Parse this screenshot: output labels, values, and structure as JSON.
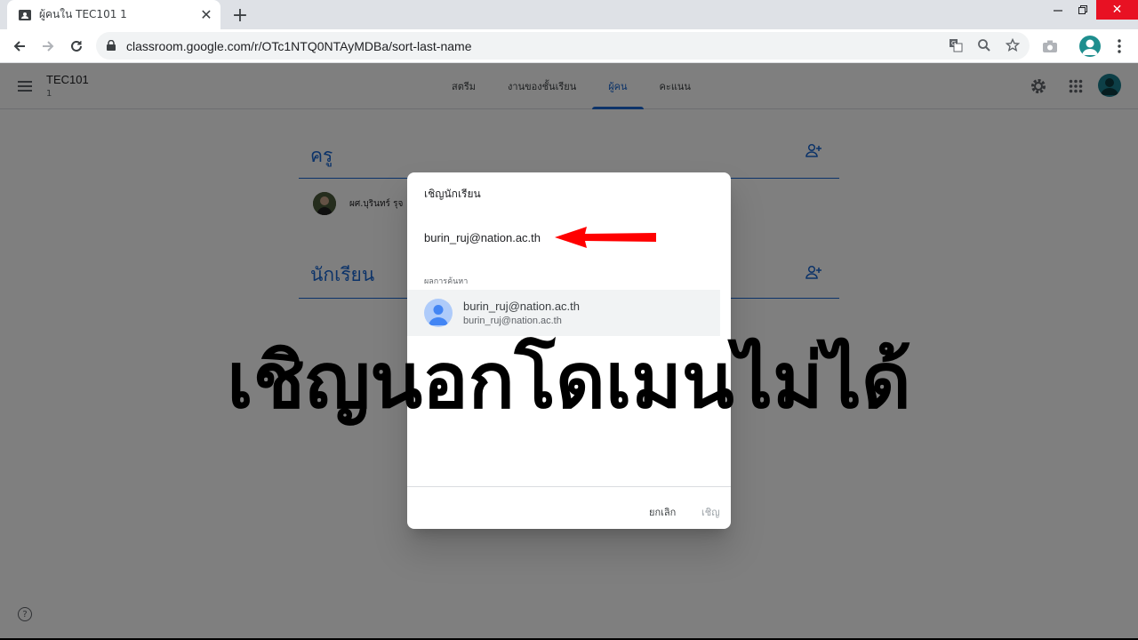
{
  "browser": {
    "tab_title": "ผู้คนใน TEC101 1",
    "url": "classroom.google.com/r/OTc1NTQ0NTAyMDBa/sort-last-name"
  },
  "icons": {
    "tab_favicon": "classroom-icon",
    "tab_close": "close-icon",
    "new_tab": "plus-icon",
    "back": "arrow-back-icon",
    "forward": "arrow-forward-icon",
    "reload": "reload-icon",
    "lock": "lock-icon",
    "translate": "translate-icon",
    "zoom": "zoom-icon",
    "bookmark": "star-icon",
    "camera": "camera-icon",
    "menu": "kebab-menu-icon",
    "settings": "gear-icon",
    "apps": "apps-grid-icon",
    "add_person": "person-add-icon",
    "help": "help-icon"
  },
  "header": {
    "course_title": "TEC101",
    "course_section": "1",
    "tabs": [
      {
        "label": "สตรีม",
        "active": false
      },
      {
        "label": "งานของชั้นเรียน",
        "active": false
      },
      {
        "label": "ผู้คน",
        "active": true
      },
      {
        "label": "คะแนน",
        "active": false
      }
    ]
  },
  "people": {
    "teachers_heading": "ครู",
    "teacher_name": "ผศ.บุรินทร์ รุจ",
    "students_heading": "นักเรียน"
  },
  "dialog": {
    "title": "เชิญนักเรียน",
    "input_value": "burin_ruj@nation.ac.th",
    "results_label": "ผลการค้นหา",
    "result_name": "burin_ruj@nation.ac.th",
    "result_email": "burin_ruj@nation.ac.th",
    "cancel_label": "ยกเลิก",
    "invite_label": "เชิญ"
  },
  "overlay": {
    "caption": "เชิญนอกโดเมนไม่ได้"
  },
  "colors": {
    "accent": "#1967d2",
    "arrow": "#ff0000"
  }
}
